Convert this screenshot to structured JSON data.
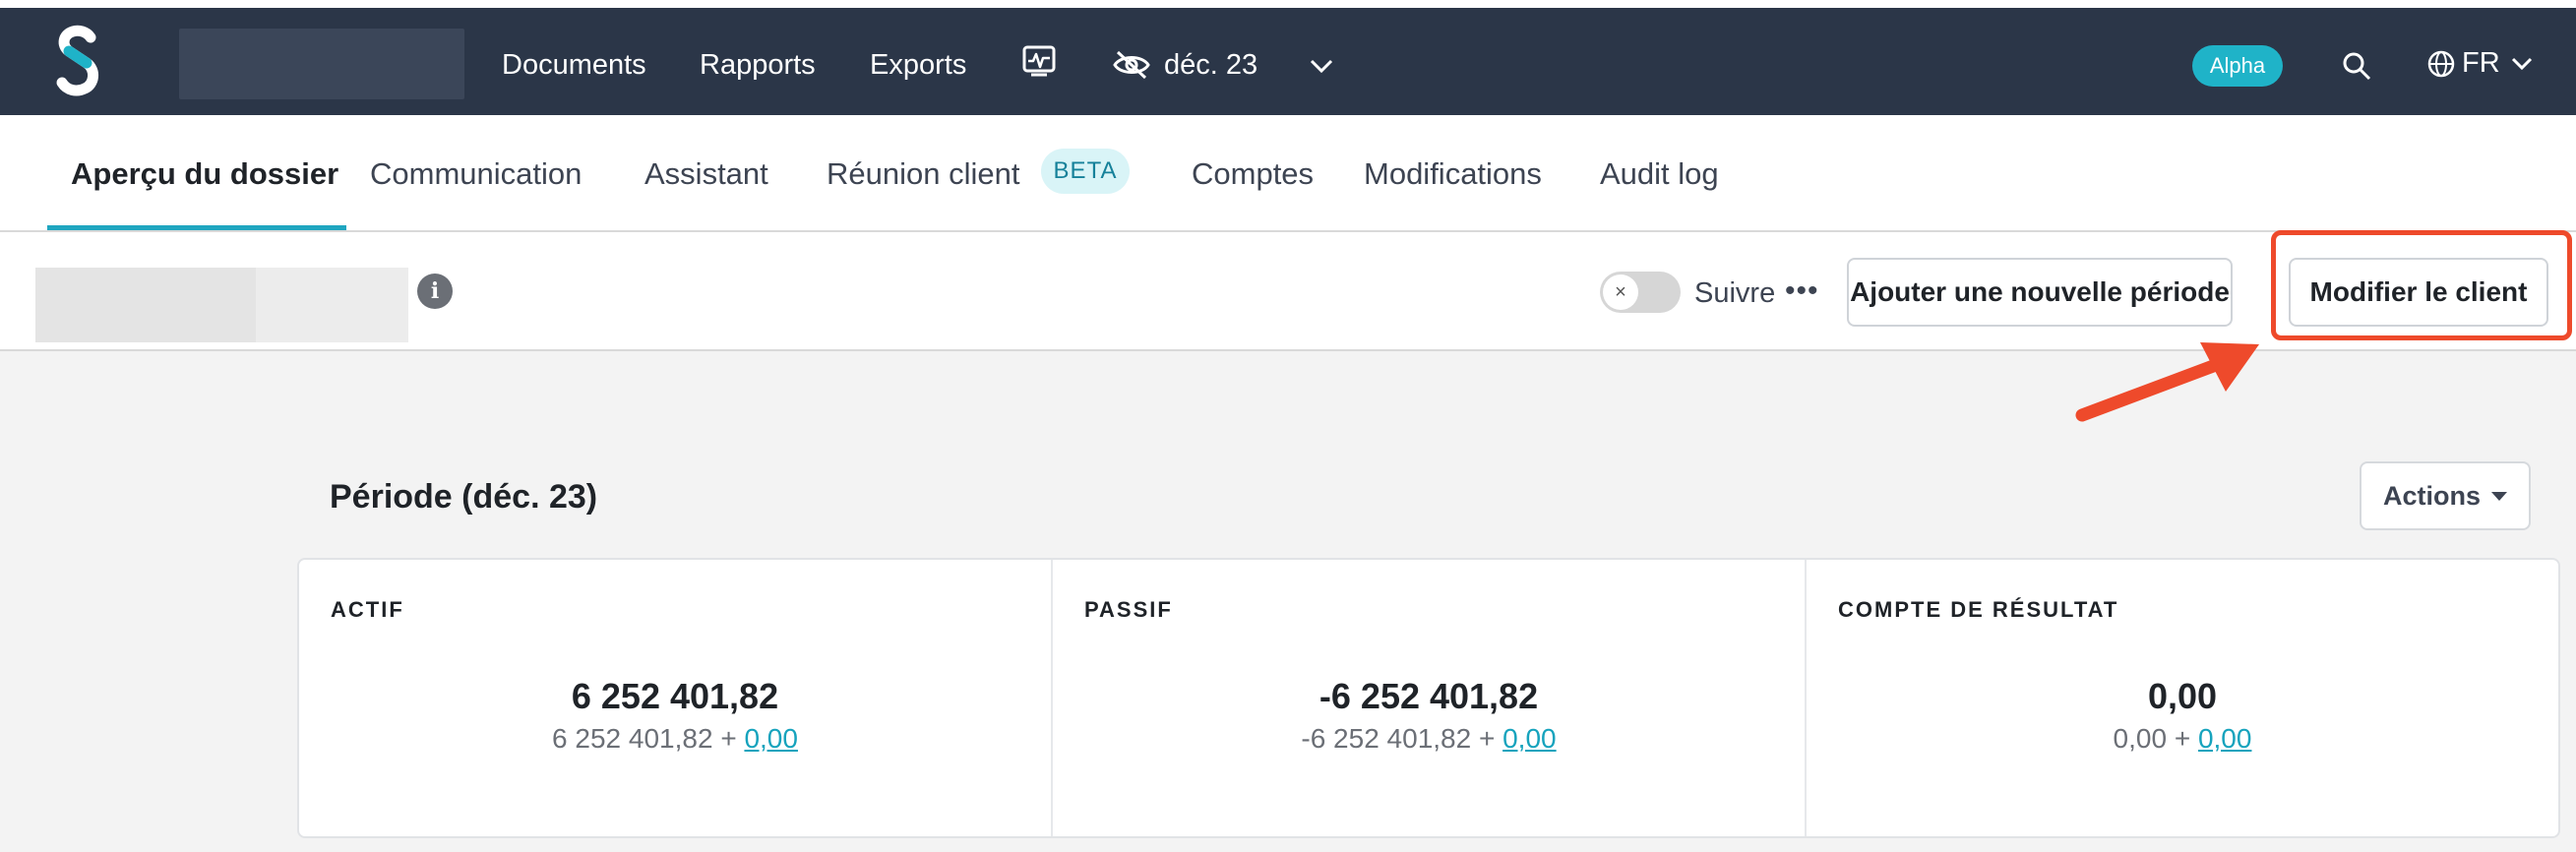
{
  "nav": {
    "links": [
      "Documents",
      "Rapports",
      "Exports"
    ],
    "period_label": "déc. 23",
    "alpha_badge": "Alpha",
    "language": "FR"
  },
  "tabs": {
    "items": [
      "Aperçu du dossier",
      "Communication",
      "Assistant",
      "Réunion client",
      "Comptes",
      "Modifications",
      "Audit log"
    ],
    "beta_badge": "BETA"
  },
  "toolbar": {
    "info_glyph": "i",
    "toggle_glyph": "×",
    "follow_label": "Suivre",
    "more_glyph": "•••",
    "add_period_label": "Ajouter une nouvelle période",
    "edit_client_label": "Modifier le client"
  },
  "period": {
    "title": "Période (déc. 23)",
    "actions_label": "Actions",
    "summary": [
      {
        "label": "ACTIF",
        "total": "6 252 401,82",
        "base": "6 252 401,82 + ",
        "delta": "0,00"
      },
      {
        "label": "PASSIF",
        "total": "-6 252 401,82",
        "base": "-6 252 401,82 + ",
        "delta": "0,00"
      },
      {
        "label": "COMPTE DE RÉSULTAT",
        "total": "0,00",
        "base": "0,00 + ",
        "delta": "0,00"
      }
    ]
  },
  "colors": {
    "topbar": "#2b3648",
    "accent": "#1fb3c8",
    "highlight": "#ee4a2b"
  }
}
